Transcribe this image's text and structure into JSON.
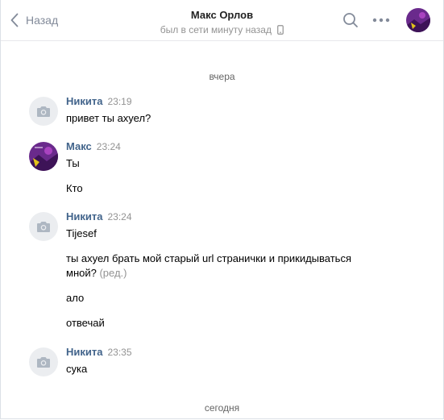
{
  "header": {
    "back_label": "Назад",
    "peer_name": "Макс Орлов",
    "peer_status": "был в сети минуту назад"
  },
  "date_separators": [
    "вчера",
    "сегодня"
  ],
  "messages": [
    {
      "author": "Никита",
      "time": "23:19",
      "avatar": "camera-placeholder",
      "lines": [
        "привет ты ахуел?"
      ]
    },
    {
      "author": "Макс",
      "time": "23:24",
      "avatar": "purple-photo",
      "lines": [
        "Ты",
        "Кто"
      ]
    },
    {
      "author": "Никита",
      "time": "23:24",
      "avatar": "camera-placeholder",
      "lines": [
        "Tijesef",
        "ты ахуел брать мой старый url странички и прикидываться",
        "мной?",
        "ало",
        "отвечай"
      ],
      "edited_mark": "(ред.)"
    },
    {
      "author": "Никита",
      "time": "23:35",
      "avatar": "camera-placeholder",
      "lines": [
        "сука"
      ]
    }
  ],
  "colors": {
    "author": "#42648b",
    "meta": "#939393",
    "divider": "#e7e8ec",
    "placeholder_avatar": "#ebedf0",
    "photo_avatar": "#6a2a8c"
  }
}
